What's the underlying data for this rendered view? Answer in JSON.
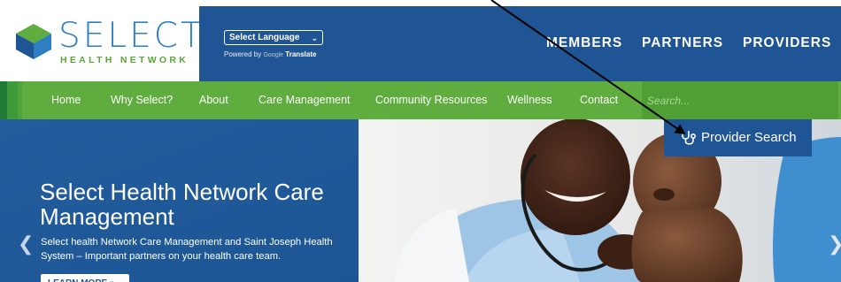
{
  "logo": {
    "name": "SELECT",
    "tagline": "HEALTH NETWORK"
  },
  "header": {
    "language_select": "Select Language",
    "powered_by": "Powered by",
    "google": "Google",
    "translate": "Translate",
    "links": [
      "MEMBERS",
      "PARTNERS",
      "PROVIDERS"
    ]
  },
  "nav": {
    "items": [
      "Home",
      "Why Select?",
      "About",
      "Care Management",
      "Community Resources",
      "Wellness",
      "Contact"
    ],
    "search_placeholder": "Search..."
  },
  "hero": {
    "title": "Select Health Network Care Management",
    "description": "Select health Network Care Management and Saint Joseph Health System – Important partners on your health care team.",
    "cta": "LEARN MORE »"
  },
  "provider_search": {
    "label": "Provider Search"
  },
  "colors": {
    "brand_blue": "#1f5595",
    "brand_green": "#5fad3e",
    "logo_blue": "#2e7fc2"
  }
}
